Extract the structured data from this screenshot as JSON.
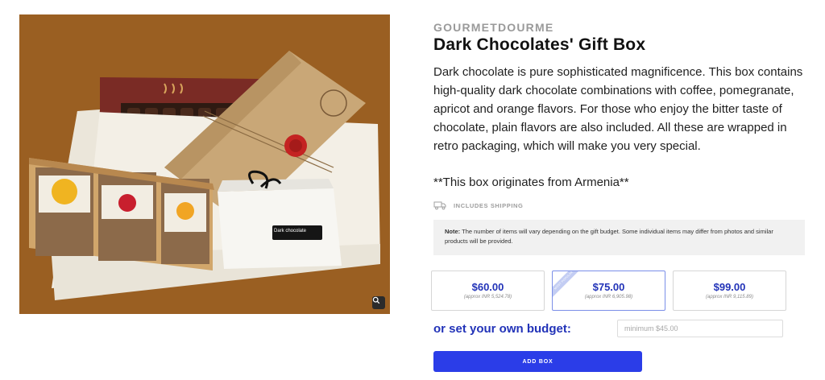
{
  "product": {
    "brand": "GOURMETDOURME",
    "title": "Dark Chocolates' Gift Box",
    "description": "Dark chocolate is pure sophisticated magnificence. This box contains high-quality dark chocolate combinations with coffee, pomegranate, apricot and orange flavors. For those who enjoy the bitter taste of chocolate, plain flavors are also included.  All these are wrapped in retro packaging, which will make you very special.",
    "origin": "**This box originates from Armenia**"
  },
  "image": {
    "box_label": "Dark chocolate",
    "package_labels": [
      "orange",
      "pomegranate",
      "apricot"
    ],
    "background_color": "#9a5f22",
    "zoom_icon": "magnifier-icon"
  },
  "shipping": {
    "icon": "truck-icon",
    "label": "INCLUDES SHIPPING"
  },
  "note": {
    "label": "Note:",
    "text": " The number of items will vary depending on the gift budget. Some individual items may differ from photos and similar products will be provided."
  },
  "budgets": [
    {
      "price": "$60.00",
      "approx": "(approx INR 5,524.78)",
      "selected": false,
      "ribbon": ""
    },
    {
      "price": "$75.00",
      "approx": "(approx INR 6,905.98)",
      "selected": true,
      "ribbon": "Most Popular"
    },
    {
      "price": "$99.00",
      "approx": "(approx INR 9,115.89)",
      "selected": false,
      "ribbon": ""
    }
  ],
  "custom_budget": {
    "label": "or set your own budget:",
    "placeholder": "minimum $45.00",
    "value": ""
  },
  "actions": {
    "add_label": "ADD BOX"
  },
  "colors": {
    "accent": "#2b3de8",
    "price_text": "#2233b8",
    "selected_border": "#7b8fe8"
  }
}
